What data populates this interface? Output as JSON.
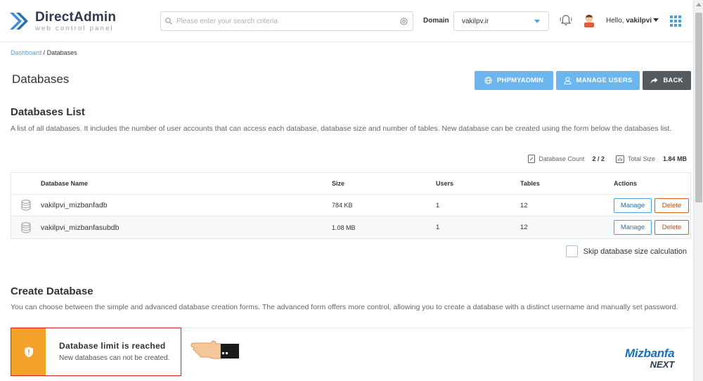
{
  "header": {
    "logo_title": "DirectAdmin",
    "logo_subtitle": "web control panel",
    "search_placeholder": "Please enter your search criteria",
    "domain_label": "Domain",
    "domain_value": "vakilpv.ir",
    "hello_prefix": "Hello,",
    "username": "vakilpvi"
  },
  "breadcrumb": {
    "home": "Dashboard",
    "separator": "/",
    "current": "Databases"
  },
  "page": {
    "title": "Databases",
    "buttons": {
      "phpmyadmin": "PHPMYADMIN",
      "manage_users": "MANAGE USERS",
      "back": "BACK"
    }
  },
  "db_list": {
    "title": "Databases List",
    "description": "A list of all databases. It includes the number of user accounts that can access each database, database size and number of tables. New database can be created using the form below the databases list.",
    "count_label": "Database Count",
    "count_value": "2 / 2",
    "size_label": "Total Size",
    "size_value": "1.84 MB",
    "columns": {
      "name": "Database Name",
      "size": "Size",
      "users": "Users",
      "tables": "Tables",
      "actions": "Actions"
    },
    "rows": [
      {
        "name": "vakilpvi_mizbanfadb",
        "size": "784 KB",
        "users": "1",
        "tables": "12"
      },
      {
        "name": "vakilpvi_mizbanfasubdb",
        "size": "1.08 MB",
        "users": "1",
        "tables": "12"
      }
    ],
    "manage_label": "Manage",
    "delete_label": "Delete",
    "skip_label": "Skip database size calculation"
  },
  "create": {
    "title": "Create Database",
    "description": "You can choose between the simple and advanced database creation forms. The advanced form offers more control, allowing you to create a database with a distinct username and manually set password.",
    "alert_title": "Database limit is reached",
    "alert_text": "New databases can not be created."
  },
  "watermark": {
    "top": "Mizbanfa",
    "bottom": "NEXT"
  },
  "colors": {
    "accent": "#4aa3e0",
    "button_light": "#6cb6ef",
    "warning": "#f4a12a",
    "danger": "#d3241b"
  }
}
